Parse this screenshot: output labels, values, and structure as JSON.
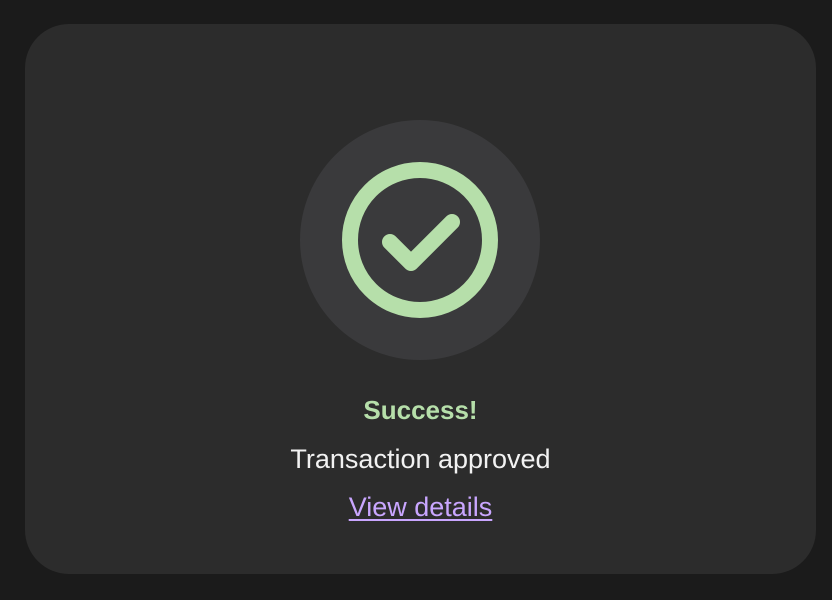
{
  "status": {
    "icon": "check-circle-icon",
    "title": "Success!",
    "message": "Transaction approved",
    "link_label": "View details"
  },
  "colors": {
    "background": "#1b1b1b",
    "card": "#2c2c2c",
    "icon_background": "#3a3a3c",
    "success": "#b6dfaa",
    "text": "#f2f2f2",
    "link": "#c9a6ff"
  }
}
